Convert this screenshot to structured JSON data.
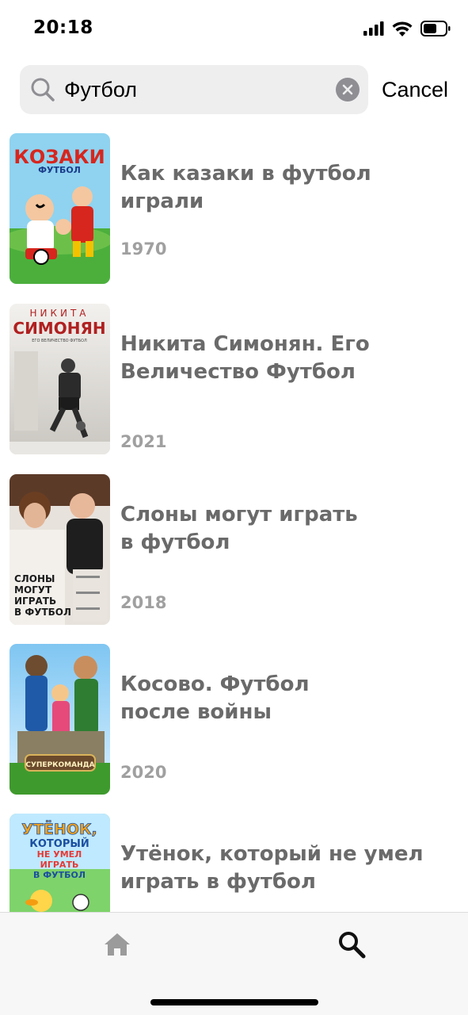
{
  "status_bar": {
    "time": "20:18",
    "icons": [
      "signal-icon",
      "wifi-icon",
      "battery-icon"
    ]
  },
  "search": {
    "value": "Футбол",
    "placeholder": "",
    "cancel_label": "Cancel"
  },
  "results": [
    {
      "title": "Как казаки в футбол играли",
      "year": "1970",
      "poster_text": [
        "КОЗАКИ",
        "ФУТБОЛ"
      ]
    },
    {
      "title": "Никита Симонян. Его\nВеличество Футбол",
      "year": "2021",
      "poster_text": [
        "НИКИТА",
        "СИМОНЯН",
        "ЕГО ВЕЛИЧЕСТВО ФУТБОЛ"
      ]
    },
    {
      "title": "Слоны могут играть\nв футбол",
      "year": "2018",
      "poster_text": [
        "СЛОНЫ",
        "МОГУТ",
        "ИГРАТЬ",
        "В ФУТБОЛ"
      ]
    },
    {
      "title": "Косово. Футбол\nпосле войны",
      "year": "2020",
      "poster_text": [
        "СУПЕРКОМАНДА"
      ]
    },
    {
      "title": "Утёнок, который не умел\nиграть в футбол",
      "year": "",
      "poster_text": [
        "УТЁНОК,",
        "КОТОРЫЙ",
        "НЕ УМЕЛ",
        "ИГРАТЬ",
        "В ФУТБОЛ"
      ]
    }
  ],
  "tab_bar": {
    "tabs": [
      {
        "icon": "home-icon",
        "active": false
      },
      {
        "icon": "search-icon",
        "active": true
      }
    ]
  },
  "colors": {
    "search_background": "#eeeeef",
    "title_text": "#6a6a6a",
    "year_text": "#a0a0a0",
    "tab_bar_background": "#f7f7f7"
  }
}
